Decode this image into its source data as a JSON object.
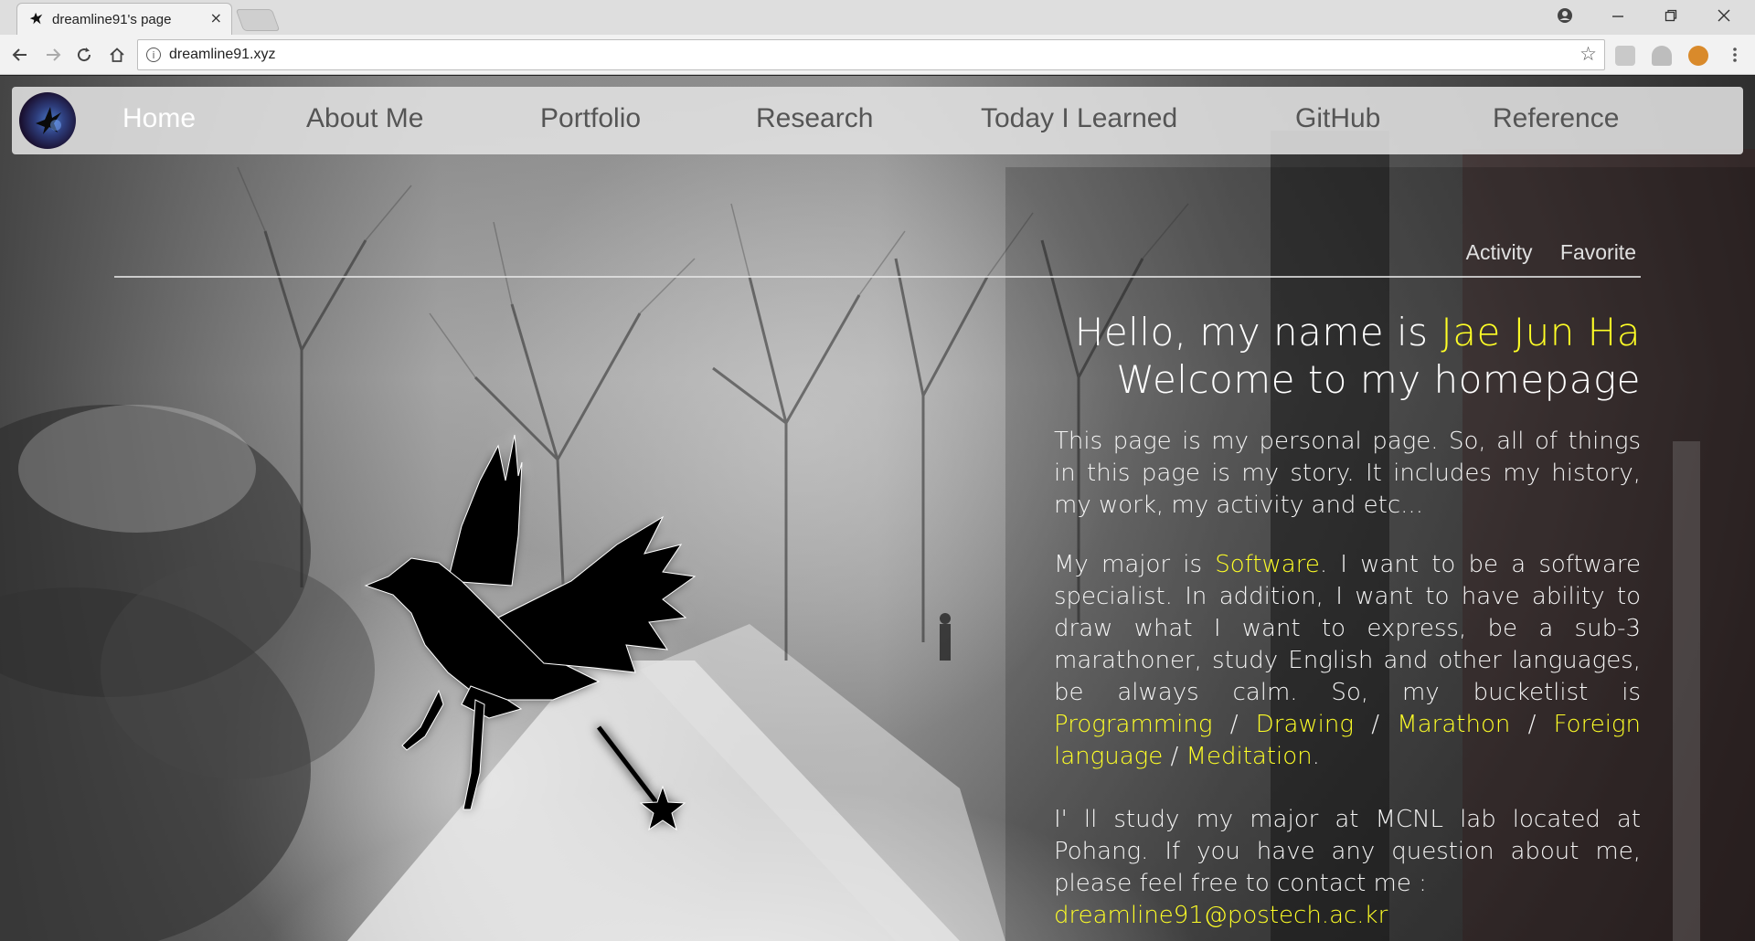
{
  "browser": {
    "tab_title": "dreamline91's page",
    "tab_close": "×",
    "url": "dreamline91.xyz"
  },
  "site": {
    "nav": [
      {
        "label": "Home",
        "active": true
      },
      {
        "label": "About Me"
      },
      {
        "label": "Portfolio"
      },
      {
        "label": "Research"
      },
      {
        "label": "Today I Learned"
      },
      {
        "label": "GitHub"
      },
      {
        "label": "Reference"
      }
    ],
    "subnav": [
      "Activity",
      "Favorite"
    ],
    "greeting": {
      "line1_prefix": "Hello, my name is ",
      "name": "Jae Jun Ha",
      "line2": "Welcome to my homepage"
    },
    "paragraph1": "This page is my personal page. So, all of things in this page is my story. It includes my history, my work, my activity and etc...",
    "paragraph2": {
      "t1": "My major is ",
      "major": "Software",
      "t2": ". I want to be a software specialist. In addition, I want to have ability to draw what I want to express, be a sub-3 marathoner, study English and other languages, be always calm. So, my bucketlist is ",
      "b1": "Programming",
      "sep1": " / ",
      "b2": "Drawing",
      "sep2": " / ",
      "b3": "Marathon",
      "sep3": " / ",
      "b4": "Foreign language",
      "sep4": " / ",
      "b5": "Meditation",
      "t3": "."
    },
    "paragraph3": "I' ll study my major at MCNL lab located at Pohang. If you have any question about me, please feel free to contact me :",
    "email": "dreamline91@postech.ac.kr",
    "highlight_color": "#ffff26"
  }
}
